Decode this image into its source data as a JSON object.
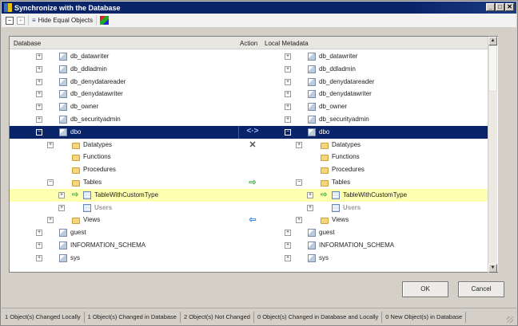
{
  "window": {
    "title": "Synchronize with the Database"
  },
  "toolbar": {
    "hide_equal_label": "Hide Equal Objects"
  },
  "columns": {
    "database": "Database",
    "action": "Action",
    "local": "Local Metadata"
  },
  "rows": [
    {
      "name": "db_datawriter",
      "level": 0,
      "exp": "+",
      "icon": "schema"
    },
    {
      "name": "db_ddladmin",
      "level": 0,
      "exp": "+",
      "icon": "schema"
    },
    {
      "name": "db_denydatareader",
      "level": 0,
      "exp": "+",
      "icon": "schema"
    },
    {
      "name": "db_denydatawriter",
      "level": 0,
      "exp": "+",
      "icon": "schema"
    },
    {
      "name": "db_owner",
      "level": 0,
      "exp": "+",
      "icon": "schema"
    },
    {
      "name": "db_securityadmin",
      "level": 0,
      "exp": "+",
      "icon": "schema"
    },
    {
      "name": "dbo",
      "level": 0,
      "exp": "-",
      "icon": "schema",
      "state": "selected",
      "action": "both"
    },
    {
      "name": "Datatypes",
      "level": 1,
      "exp": "+",
      "icon": "folder",
      "action": "x"
    },
    {
      "name": "Functions",
      "level": 1,
      "exp": "",
      "icon": "folder"
    },
    {
      "name": "Procedures",
      "level": 1,
      "exp": "",
      "icon": "folder"
    },
    {
      "name": "Tables",
      "level": 1,
      "exp": "-",
      "icon": "folder",
      "action": "right"
    },
    {
      "name": "TableWithCustomType",
      "level": 2,
      "exp": "+",
      "icon": "table",
      "state": "changed",
      "arrow": true
    },
    {
      "name": "Users",
      "level": 2,
      "exp": "+",
      "icon": "table",
      "state": "grey"
    },
    {
      "name": "Views",
      "level": 1,
      "exp": "+",
      "icon": "folder",
      "action": "left"
    },
    {
      "name": "guest",
      "level": 0,
      "exp": "+",
      "icon": "schema"
    },
    {
      "name": "INFORMATION_SCHEMA",
      "level": 0,
      "exp": "+",
      "icon": "schema"
    },
    {
      "name": "sys",
      "level": 0,
      "exp": "+",
      "icon": "schema"
    }
  ],
  "action_glyphs": {
    "both": "<·>",
    "x": "✕",
    "right": "⇨",
    "left": "⇦"
  },
  "buttons": {
    "ok": "OK",
    "cancel": "Cancel"
  },
  "status": [
    "1 Object(s) Changed Locally",
    "1 Object(s) Changed in Database",
    "2 Object(s) Not Changed",
    "0 Object(s) Changed in Database and Locally",
    "0 New Object(s) in Database"
  ],
  "colors": {
    "selection": "#0a246a",
    "changed": "#ffffb0"
  }
}
